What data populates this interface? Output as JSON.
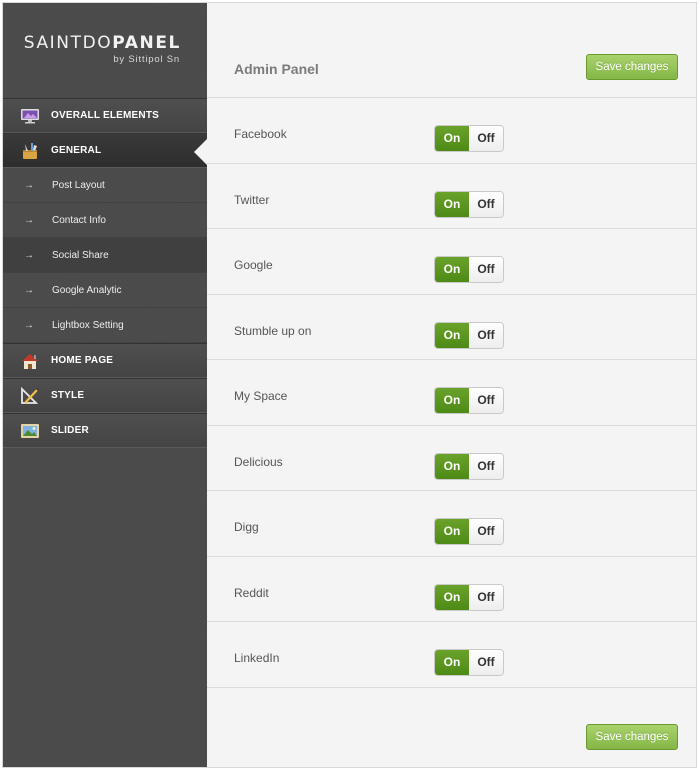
{
  "logo": {
    "title_light": "SAINTDO",
    "title_bold": "PANEL",
    "subtitle": "by Sittipol Sn"
  },
  "sidebar": {
    "items": [
      {
        "label": "OVERALL ELEMENTS",
        "icon": "monitor-icon"
      },
      {
        "label": "GENERAL",
        "icon": "tools-icon",
        "active": true
      },
      {
        "label": "HOME PAGE",
        "icon": "home-icon"
      },
      {
        "label": "STYLE",
        "icon": "drafting-icon"
      },
      {
        "label": "SLIDER",
        "icon": "picture-icon"
      }
    ],
    "sub_items": [
      {
        "label": "Post Layout"
      },
      {
        "label": "Contact Info"
      },
      {
        "label": "Social Share",
        "highlighted": true
      },
      {
        "label": "Google Analytic"
      },
      {
        "label": "Lightbox Setting"
      }
    ]
  },
  "header": {
    "title": "Admin Panel",
    "save_label": "Save changes"
  },
  "settings": [
    {
      "label": "Facebook",
      "on": "On",
      "off": "Off",
      "state": "on"
    },
    {
      "label": "Twitter",
      "on": "On",
      "off": "Off",
      "state": "on"
    },
    {
      "label": "Google",
      "on": "On",
      "off": "Off",
      "state": "on"
    },
    {
      "label": "Stumble up on",
      "on": "On",
      "off": "Off",
      "state": "on"
    },
    {
      "label": "My Space",
      "on": "On",
      "off": "Off",
      "state": "on"
    },
    {
      "label": "Delicious",
      "on": "On",
      "off": "Off",
      "state": "on"
    },
    {
      "label": "Digg",
      "on": "On",
      "off": "Off",
      "state": "on"
    },
    {
      "label": "Reddit",
      "on": "On",
      "off": "Off",
      "state": "on"
    },
    {
      "label": "LinkedIn",
      "on": "On",
      "off": "Off",
      "state": "on"
    }
  ],
  "footer": {
    "save_label": "Save changes"
  },
  "colors": {
    "accent": "#7cb342",
    "sidebar": "#4a4a4a",
    "toggle_on": "#5a9a1f"
  }
}
